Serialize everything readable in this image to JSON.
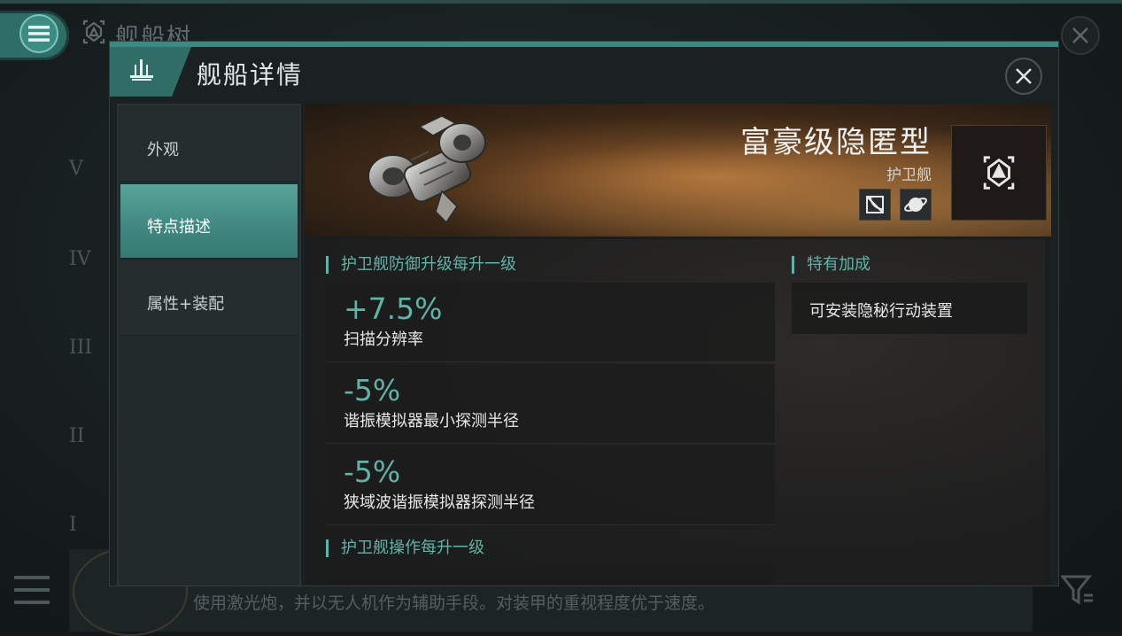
{
  "background": {
    "title": "舰船树",
    "tiers": [
      "V",
      "IV",
      "III",
      "II",
      "I"
    ],
    "description": "使用激光炮，并以无人机作为辅助手段。对装甲的重视程度优于速度。"
  },
  "modal": {
    "title": "舰船详情",
    "sidebar": [
      {
        "label": "外观"
      },
      {
        "label": "特点描述"
      },
      {
        "label": "属性+装配"
      }
    ],
    "ship": {
      "name": "富豪级隐匿型",
      "class": "护卫舰"
    },
    "frigate_defense_section": {
      "title": "护卫舰防御升级每升一级",
      "bonuses": [
        {
          "value": "+7.5%",
          "description": "扫描分辨率"
        },
        {
          "value": "-5%",
          "description": "谐振模拟器最小探测半径"
        },
        {
          "value": "-5%",
          "description": "狭域波谐振模拟器探测半径"
        }
      ]
    },
    "frigate_ops_section": {
      "title": "护卫舰操作每升一级"
    },
    "special_section": {
      "title": "特有加成",
      "items": [
        "可安装隐秘行动装置"
      ]
    }
  },
  "colors": {
    "accent": "#5fb3a8",
    "active_tab": "#3f8780",
    "panel": "#1a2123"
  },
  "icons": [
    "menu-icon",
    "ship-tree-icon",
    "close-icon",
    "fleet-icon",
    "role-icon-ewar",
    "role-icon-planet",
    "ship-type-icon",
    "list-icon",
    "filter-icon"
  ]
}
